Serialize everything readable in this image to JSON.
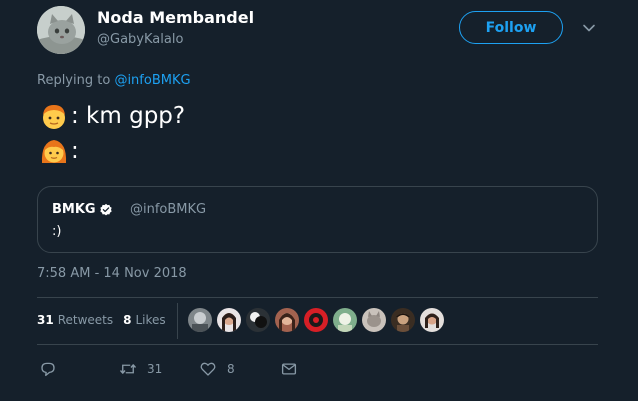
{
  "author": {
    "display_name": "Noda Membandel",
    "handle": "@GabyKalalo"
  },
  "follow_label": "Follow",
  "replying": {
    "prefix": "Replying to ",
    "mention": "@infoBMKG"
  },
  "tweet_text": {
    "line1": ": km gpp?",
    "line2": ":"
  },
  "quoted": {
    "display_name": "BMKG",
    "handle": "@infoBMKG",
    "text": ":)"
  },
  "timestamp": "7:58 AM - 14 Nov 2018",
  "stats": {
    "retweets_count": "31",
    "retweets_label": "Retweets",
    "likes_count": "8",
    "likes_label": "Likes"
  },
  "actions": {
    "retweet_count": "31",
    "like_count": "8"
  },
  "colors": {
    "background": "#15202b",
    "accent": "#1da1f2",
    "muted_text": "#8899a6",
    "border": "#38444d"
  },
  "icons": {
    "reply": "reply-icon",
    "retweet": "retweet-icon",
    "like": "heart-icon",
    "message": "envelope-icon",
    "verified": "verified-badge-icon",
    "caret": "chevron-down-icon"
  }
}
